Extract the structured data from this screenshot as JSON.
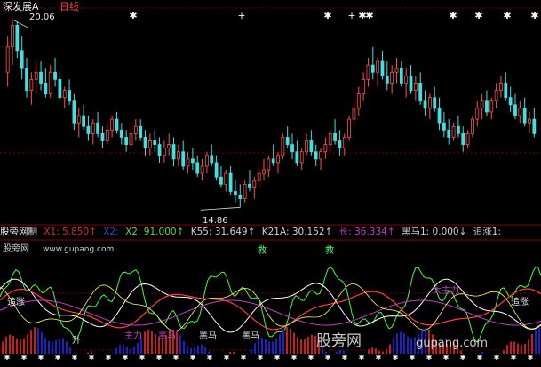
{
  "title": "深发展A",
  "period": "日线",
  "price": {
    "high_label": "20.06",
    "low_label": "14.86",
    "ylim": [
      14.5,
      20.4
    ],
    "candles": [
      [
        18.6,
        19.6,
        18.2,
        19.3
      ],
      [
        19.3,
        20.06,
        18.8,
        19.9
      ],
      [
        19.9,
        20.0,
        19.0,
        19.2
      ],
      [
        19.2,
        19.6,
        18.4,
        18.7
      ],
      [
        18.7,
        19.0,
        17.9,
        18.1
      ],
      [
        18.1,
        18.6,
        17.7,
        18.4
      ],
      [
        18.4,
        18.9,
        18.0,
        18.6
      ],
      [
        18.6,
        18.9,
        18.1,
        18.3
      ],
      [
        18.3,
        18.7,
        17.9,
        18.0
      ],
      [
        18.0,
        18.8,
        17.9,
        18.6
      ],
      [
        18.6,
        19.0,
        18.2,
        18.4
      ],
      [
        18.4,
        18.6,
        17.8,
        17.9
      ],
      [
        17.9,
        18.2,
        17.6,
        18.1
      ],
      [
        18.1,
        18.4,
        17.7,
        17.8
      ],
      [
        17.8,
        18.0,
        17.0,
        17.2
      ],
      [
        17.2,
        17.6,
        16.8,
        17.4
      ],
      [
        17.4,
        17.7,
        17.0,
        17.1
      ],
      [
        17.1,
        17.4,
        16.7,
        16.9
      ],
      [
        16.9,
        17.3,
        16.6,
        17.2
      ],
      [
        17.2,
        17.5,
        16.8,
        16.9
      ],
      [
        16.9,
        17.1,
        16.5,
        16.7
      ],
      [
        16.7,
        17.2,
        16.6,
        17.0
      ],
      [
        17.0,
        17.4,
        16.8,
        17.3
      ],
      [
        17.3,
        17.5,
        16.9,
        17.0
      ],
      [
        17.0,
        17.2,
        16.6,
        16.8
      ],
      [
        16.8,
        17.0,
        16.4,
        16.6
      ],
      [
        16.6,
        17.1,
        16.5,
        16.9
      ],
      [
        16.9,
        17.3,
        16.7,
        17.1
      ],
      [
        17.1,
        17.3,
        16.7,
        16.8
      ],
      [
        16.8,
        17.0,
        16.3,
        16.5
      ],
      [
        16.5,
        16.9,
        16.3,
        16.7
      ],
      [
        16.7,
        17.0,
        16.4,
        16.6
      ],
      [
        16.6,
        16.8,
        16.1,
        16.3
      ],
      [
        16.3,
        16.7,
        16.1,
        16.5
      ],
      [
        16.5,
        16.9,
        16.3,
        16.6
      ],
      [
        16.6,
        16.8,
        16.0,
        16.2
      ],
      [
        16.2,
        16.6,
        16.0,
        16.4
      ],
      [
        16.4,
        16.7,
        15.9,
        16.0
      ],
      [
        16.0,
        16.4,
        15.8,
        16.2
      ],
      [
        16.2,
        16.5,
        15.9,
        16.1
      ],
      [
        16.1,
        16.3,
        15.7,
        15.8
      ],
      [
        15.8,
        16.2,
        15.6,
        16.0
      ],
      [
        16.0,
        16.4,
        15.8,
        16.3
      ],
      [
        16.3,
        16.6,
        16.0,
        16.1
      ],
      [
        16.1,
        16.3,
        15.6,
        15.7
      ],
      [
        15.7,
        16.0,
        15.4,
        15.5
      ],
      [
        15.5,
        15.9,
        15.3,
        15.8
      ],
      [
        15.8,
        16.0,
        15.2,
        15.3
      ],
      [
        15.3,
        15.6,
        15.0,
        15.2
      ],
      [
        15.2,
        15.5,
        14.86,
        15.1
      ],
      [
        15.1,
        15.6,
        15.0,
        15.5
      ],
      [
        15.5,
        15.9,
        15.3,
        15.4
      ],
      [
        15.4,
        15.7,
        15.1,
        15.6
      ],
      [
        15.6,
        16.0,
        15.4,
        15.8
      ],
      [
        15.8,
        16.2,
        15.6,
        15.9
      ],
      [
        15.9,
        16.3,
        15.7,
        16.2
      ],
      [
        16.2,
        16.6,
        16.0,
        16.1
      ],
      [
        16.1,
        16.4,
        15.8,
        16.3
      ],
      [
        16.3,
        16.9,
        16.2,
        16.8
      ],
      [
        16.8,
        17.1,
        16.5,
        16.6
      ],
      [
        16.6,
        16.9,
        16.2,
        16.4
      ],
      [
        16.4,
        16.7,
        16.0,
        16.1
      ],
      [
        16.1,
        16.5,
        15.9,
        16.4
      ],
      [
        16.4,
        16.9,
        16.3,
        16.7
      ],
      [
        16.7,
        17.0,
        16.3,
        16.4
      ],
      [
        16.4,
        16.6,
        16.0,
        16.2
      ],
      [
        16.2,
        16.5,
        15.9,
        16.4
      ],
      [
        16.4,
        16.8,
        16.2,
        16.6
      ],
      [
        16.6,
        17.0,
        16.4,
        16.9
      ],
      [
        16.9,
        17.3,
        16.6,
        16.7
      ],
      [
        16.7,
        17.0,
        16.3,
        16.5
      ],
      [
        16.5,
        16.9,
        16.3,
        16.8
      ],
      [
        16.8,
        17.4,
        16.7,
        17.3
      ],
      [
        17.3,
        17.8,
        17.1,
        17.6
      ],
      [
        17.6,
        18.2,
        17.4,
        18.0
      ],
      [
        18.0,
        18.6,
        17.8,
        18.4
      ],
      [
        18.4,
        19.0,
        18.2,
        18.8
      ],
      [
        18.8,
        19.3,
        18.4,
        18.6
      ],
      [
        18.6,
        19.0,
        18.2,
        18.9
      ],
      [
        18.9,
        19.2,
        18.4,
        18.5
      ],
      [
        18.5,
        18.9,
        18.1,
        18.3
      ],
      [
        18.3,
        18.8,
        18.0,
        18.6
      ],
      [
        18.6,
        19.0,
        18.3,
        18.7
      ],
      [
        18.7,
        18.9,
        18.2,
        18.3
      ],
      [
        18.3,
        18.7,
        17.9,
        18.5
      ],
      [
        18.5,
        18.8,
        18.0,
        18.1
      ],
      [
        18.1,
        18.5,
        17.8,
        18.3
      ],
      [
        18.3,
        18.6,
        17.7,
        17.8
      ],
      [
        17.8,
        18.1,
        17.4,
        17.6
      ],
      [
        17.6,
        18.0,
        17.3,
        17.9
      ],
      [
        17.9,
        18.2,
        17.5,
        17.6
      ],
      [
        17.6,
        17.9,
        17.0,
        17.2
      ],
      [
        17.2,
        17.5,
        16.8,
        17.0
      ],
      [
        17.0,
        17.3,
        16.6,
        16.8
      ],
      [
        16.8,
        17.2,
        16.7,
        17.1
      ],
      [
        17.1,
        17.4,
        16.8,
        16.9
      ],
      [
        16.9,
        17.1,
        16.4,
        16.6
      ],
      [
        16.6,
        17.0,
        16.5,
        16.9
      ],
      [
        16.9,
        17.4,
        16.8,
        17.3
      ],
      [
        17.3,
        17.8,
        17.1,
        17.6
      ],
      [
        17.6,
        18.0,
        17.3,
        17.8
      ],
      [
        17.8,
        18.1,
        17.4,
        17.5
      ],
      [
        17.5,
        17.9,
        17.3,
        17.8
      ],
      [
        17.8,
        18.3,
        17.6,
        18.1
      ],
      [
        18.1,
        18.5,
        17.9,
        18.3
      ],
      [
        18.3,
        18.6,
        17.8,
        17.9
      ],
      [
        17.9,
        18.2,
        17.5,
        17.7
      ],
      [
        17.7,
        18.0,
        17.3,
        17.4
      ],
      [
        17.4,
        17.8,
        17.2,
        17.6
      ],
      [
        17.6,
        17.9,
        17.1,
        17.2
      ],
      [
        17.2,
        17.5,
        16.9,
        17.3
      ],
      [
        17.3,
        17.6,
        16.8,
        16.9
      ]
    ]
  },
  "indicator_bar": {
    "name": "股旁网制",
    "items": [
      {
        "text": "X1: 5.850↑",
        "color": "#d03030"
      },
      {
        "text": "X2:",
        "color": "#4040d0"
      },
      {
        "text": "X2: 91.000↑",
        "color": "#60d060"
      },
      {
        "text": "K55: 31.649↑",
        "color": "#d0d0d0"
      },
      {
        "text": "K21A: 30.152↑",
        "color": "#d0d0d0"
      },
      {
        "text": "长: 36.334↑",
        "color": "#c040c0"
      },
      {
        "text": "黑马1: 0.000↓",
        "color": "#d0d0d0"
      },
      {
        "text": "追涨1:",
        "color": "#d0d0d0"
      }
    ]
  },
  "sub_chart": {
    "site": "www.gupang.com",
    "site_prefix": "股旁网",
    "labels": {
      "zhuizhang_left": "追涨",
      "zhuizhang_right": "追涨",
      "zhuli": "主力",
      "heima1": "黑马",
      "heima2": "黑马",
      "heima3": "黑马",
      "shengtian": "升",
      "dazhuli": "大主力",
      "jiu1": "救",
      "jiu2": "救"
    },
    "watermark": "股旁网",
    "watermark_url": "gupang.com"
  }
}
